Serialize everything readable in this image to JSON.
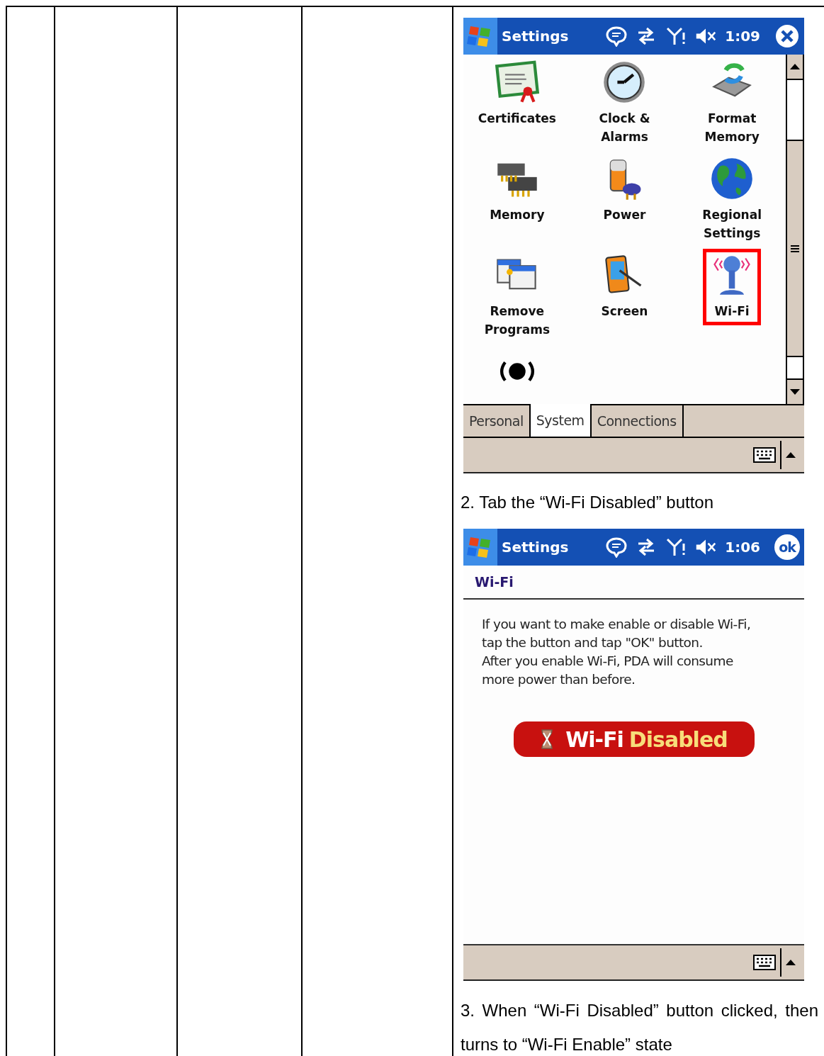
{
  "screen_1": {
    "title": "Settings",
    "time": "1:09",
    "items": [
      {
        "label": "Certificates",
        "selected": false
      },
      {
        "label": "Clock &\nAlarms",
        "selected": false
      },
      {
        "label": "Format\nMemory",
        "selected": false
      },
      {
        "label": "Memory",
        "selected": false
      },
      {
        "label": "Power",
        "selected": false
      },
      {
        "label": "Regional\nSettings",
        "selected": false
      },
      {
        "label": "Remove\nPrograms",
        "selected": false
      },
      {
        "label": "Screen",
        "selected": false
      },
      {
        "label": "Wi-Fi",
        "selected": true
      },
      {
        "selected": false
      }
    ],
    "tabs": [
      {
        "label": "Personal",
        "selected": false
      },
      {
        "label": "System",
        "selected": true
      },
      {
        "label": "Connections",
        "selected": false
      }
    ]
  },
  "step_2": "2. Tab the “Wi-Fi Disabled” button",
  "screen_2": {
    "title": "Settings",
    "time": "1:06",
    "ok_button": "ok",
    "heading": "Wi-Fi",
    "message": "If you want to make enable or disable Wi-Fi,\ntap the button and tap \"OK\" button.\nAfter you enable Wi-Fi, PDA will consume\nmore power than before.",
    "toggle": {
      "label": "Wi-Fi",
      "state": "Disabled",
      "on": false
    }
  },
  "step_3": "3. When “Wi-Fi Disabled” button clicked, then turns to “Wi-Fi Enable” state"
}
